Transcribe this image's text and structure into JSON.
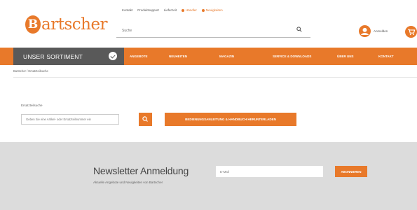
{
  "top_links": [
    "Kontakt",
    "Produktsupport",
    "Lieferzeit"
  ],
  "top_links_highlighted": [
    "Händler",
    "Neuigkeiten"
  ],
  "logo": {
    "mark": "B",
    "text": "artscher"
  },
  "search": {
    "placeholder": "Suche",
    "icon": "search-icon"
  },
  "account": {
    "label": "Anmelden",
    "icon": "user-icon"
  },
  "cart": {
    "icon": "cart-icon"
  },
  "nav": {
    "sortiment_label": "UNSER SORTIMENT",
    "items": [
      "ANGEBOTE",
      "NEUHEITEN",
      "MAGAZIN",
      "SERVICE & DOWNLOADS",
      "ÜBER UNS",
      "KONTAKT"
    ]
  },
  "breadcrumb": "Bartscher / Ersatzteilsuche",
  "spare_parts": {
    "label": "Ersatzteilsuche",
    "placeholder": "Geben Sie eine Artikel- oder Ersatzteilnummer ein",
    "manual_button": "BEDIENUNGSANLEITUNG & HANDBUCH HERUNTERLADEN"
  },
  "newsletter": {
    "title": "Newsletter Anmeldung",
    "subtitle": "Aktuelle Angebote und Neuigkeiten von Bartscher",
    "input_placeholder": "E-Mail",
    "button": "ABONNIEREN"
  },
  "colors": {
    "accent": "#e8792a",
    "nav_dark": "#595959",
    "newsletter_bg": "#dcdcdc"
  }
}
